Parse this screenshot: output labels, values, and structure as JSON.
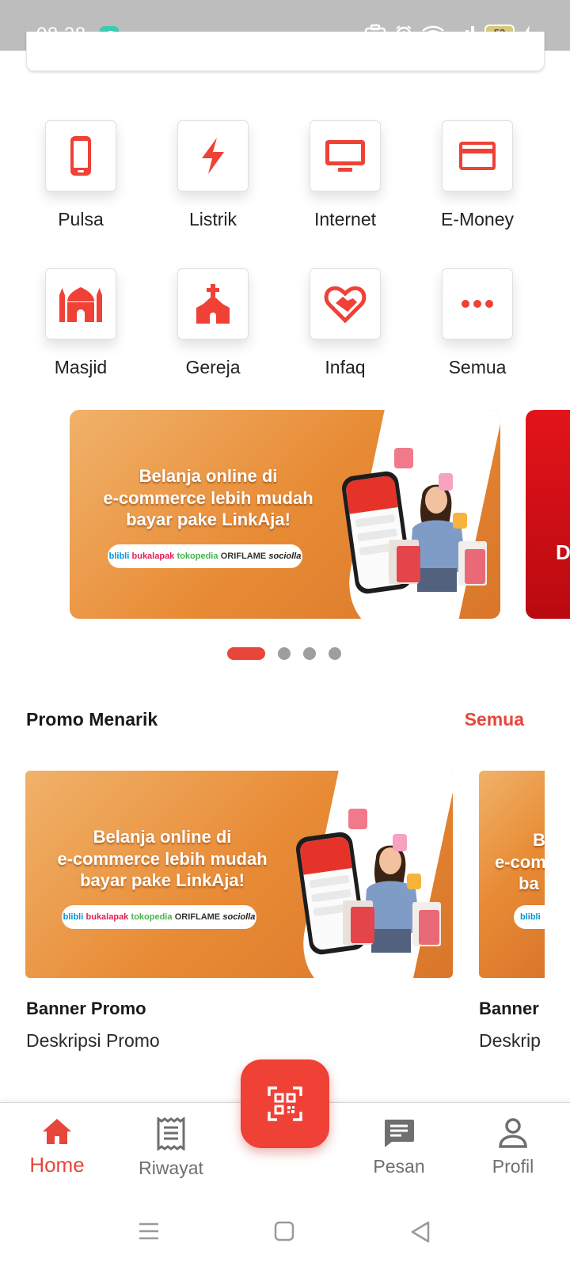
{
  "status_bar": {
    "time": "08.38",
    "battery": "53"
  },
  "menu": [
    {
      "label": "Pulsa",
      "icon": "phone-icon"
    },
    {
      "label": "Listrik",
      "icon": "lightning-icon"
    },
    {
      "label": "Internet",
      "icon": "monitor-icon"
    },
    {
      "label": "E-Money",
      "icon": "card-icon"
    },
    {
      "label": "Masjid",
      "icon": "mosque-icon"
    },
    {
      "label": "Gereja",
      "icon": "church-icon"
    },
    {
      "label": "Infaq",
      "icon": "handshake-heart-icon"
    },
    {
      "label": "Semua",
      "icon": "more-icon"
    }
  ],
  "carousel": {
    "banner_line1": "Belanja online di",
    "banner_line2": "e-commerce lebih mudah",
    "banner_line3": "bayar pake LinkAja!",
    "partners": [
      "blibli",
      "bukalapak",
      "tokopedia",
      "ORIFLAME",
      "sociolla"
    ],
    "next_banner_letter": "D",
    "dots_total": 4,
    "active_index": 0
  },
  "promo": {
    "title": "Promo Menarik",
    "see_all": "Semua",
    "items": [
      {
        "title": "Banner Promo",
        "description": "Deskripsi Promo"
      },
      {
        "title": "Banner",
        "description": "Deskrip"
      }
    ],
    "peek_lines": [
      "B",
      "e-com",
      "ba"
    ]
  },
  "bottom_nav": {
    "items": [
      {
        "label": "Home",
        "icon": "home-icon",
        "active": true
      },
      {
        "label": "Riwayat",
        "icon": "receipt-icon",
        "active": false
      },
      {
        "label": "Pesan",
        "icon": "message-icon",
        "active": false
      },
      {
        "label": "Profil",
        "icon": "person-icon",
        "active": false
      }
    ],
    "fab_icon": "qr-scan-icon"
  },
  "colors": {
    "accent": "#e8463a",
    "fab": "#ef4136",
    "banner_orange": "#e88b35",
    "status_bar": "#bdbdbd"
  }
}
